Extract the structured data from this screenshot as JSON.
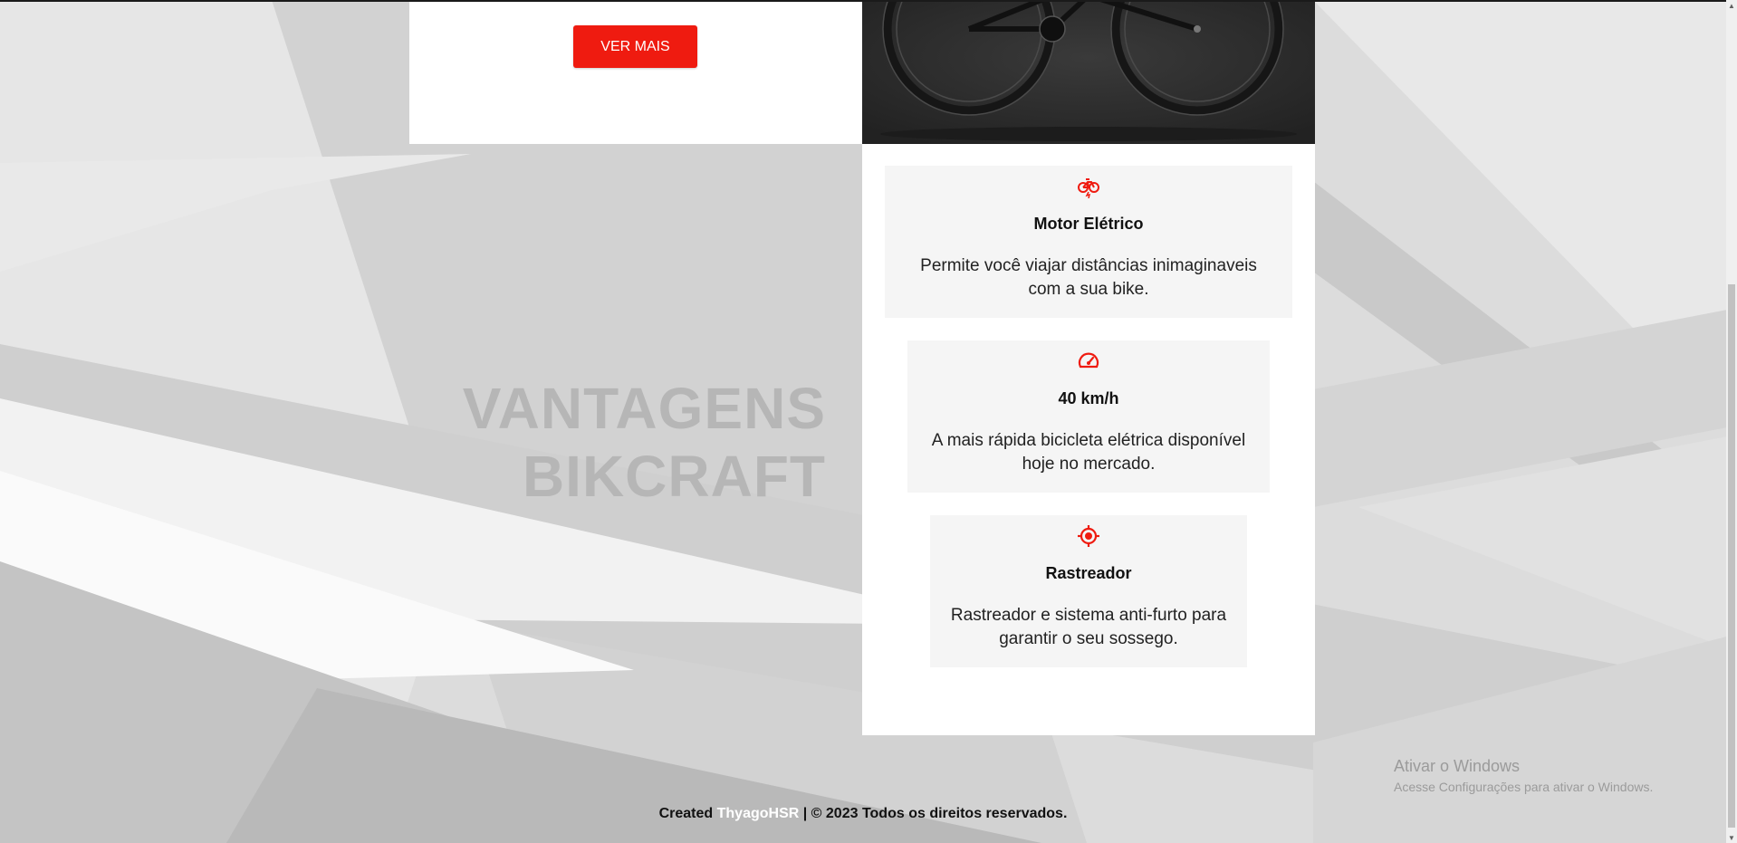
{
  "promo": {
    "button_label": "VER MAIS"
  },
  "advantages": {
    "title_line1": "VANTAGENS",
    "title_line2": "BIKCRAFT",
    "cards": [
      {
        "icon": "electric-bike-icon",
        "title": "Motor Elétrico",
        "text_line1": "Permite você viajar distâncias inimaginaveis",
        "text_line2": "com a sua bike."
      },
      {
        "icon": "speedometer-icon",
        "title": "40 km/h",
        "text_line1": "A mais rápida bicicleta elétrica disponível",
        "text_line2": "hoje no mercado."
      },
      {
        "icon": "target-icon",
        "title": "Rastreador",
        "text_line1": "Rastreador e sistema anti-furto para",
        "text_line2": "garantir o seu sossego."
      }
    ]
  },
  "footer": {
    "prefix": "Created",
    "author": "ThyagoHSR",
    "suffix": "| © 2023 Todos os direitos reservados."
  },
  "windows_watermark": {
    "line1": "Ativar o Windows",
    "line2": "Acesse Configurações para ativar o Windows."
  },
  "colors": {
    "accent": "#ef1b10",
    "title_grey": "#b6b6b6",
    "card_bg": "#f5f5f5"
  }
}
